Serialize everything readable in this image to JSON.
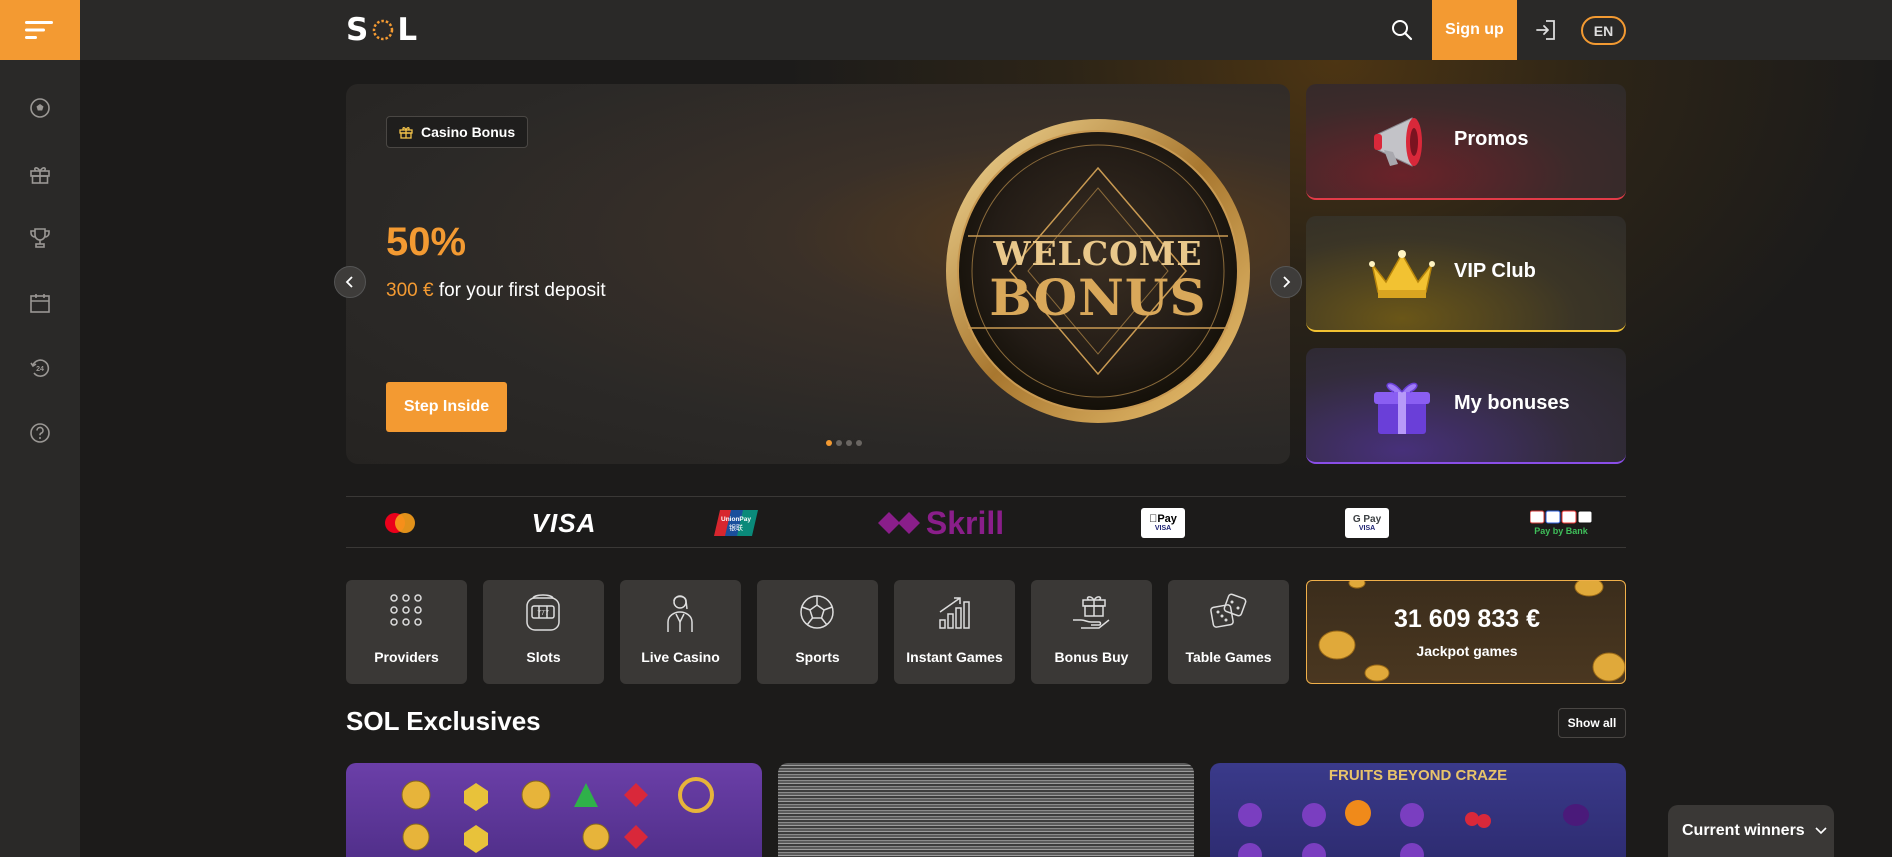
{
  "brand": {
    "logo_text_left": "S",
    "logo_text_right": "L",
    "accent": "#f39a32"
  },
  "header": {
    "signup_label": "Sign up",
    "lang_label": "EN"
  },
  "rail": {
    "icons": [
      "soccer-ball-icon",
      "gift-icon",
      "trophy-icon",
      "calendar-icon",
      "support-24-icon",
      "help-icon"
    ]
  },
  "hero": {
    "tag_label": "Casino Bonus",
    "headline": "50%",
    "amount": "300 €",
    "subtitle_rest": " for your first deposit",
    "cta_label": "Step Inside",
    "coin_line1": "WELCOME",
    "coin_line2": "BONUS",
    "slides_total": 4,
    "slide_active": 1
  },
  "side_tiles": [
    {
      "label": "Promos",
      "icon": "megaphone-icon"
    },
    {
      "label": "VIP Club",
      "icon": "crown-icon"
    },
    {
      "label": "My bonuses",
      "icon": "gift-box-icon"
    }
  ],
  "payments": {
    "visa": "VISA",
    "unionpay_top": "UnionPay",
    "unionpay_bottom": "银联",
    "skrill": "Skrill",
    "applepay": "Pay",
    "applepay_sub": "VISA",
    "googlepay": "G Pay",
    "googlepay_sub": "VISA",
    "paybybank": "Pay by Bank"
  },
  "categories": [
    {
      "label": "Providers",
      "icon": "grid-dots-icon"
    },
    {
      "label": "Slots",
      "icon": "slot-machine-icon"
    },
    {
      "label": "Live Casino",
      "icon": "dealer-icon"
    },
    {
      "label": "Sports",
      "icon": "soccer-ball-icon"
    },
    {
      "label": "Instant Games",
      "icon": "bar-chart-icon"
    },
    {
      "label": "Bonus Buy",
      "icon": "gift-hand-icon"
    },
    {
      "label": "Table Games",
      "icon": "dice-icon"
    }
  ],
  "jackpot": {
    "amount": "31 609 833 €",
    "label": "Jackpot games"
  },
  "exclusives": {
    "title": "SOL Exclusives",
    "show_all_label": "Show all",
    "games": [
      {
        "title": ""
      },
      {
        "title": ""
      },
      {
        "title": "FRUITS BEYOND CRAZE"
      }
    ]
  },
  "winners": {
    "label": "Current winners"
  }
}
